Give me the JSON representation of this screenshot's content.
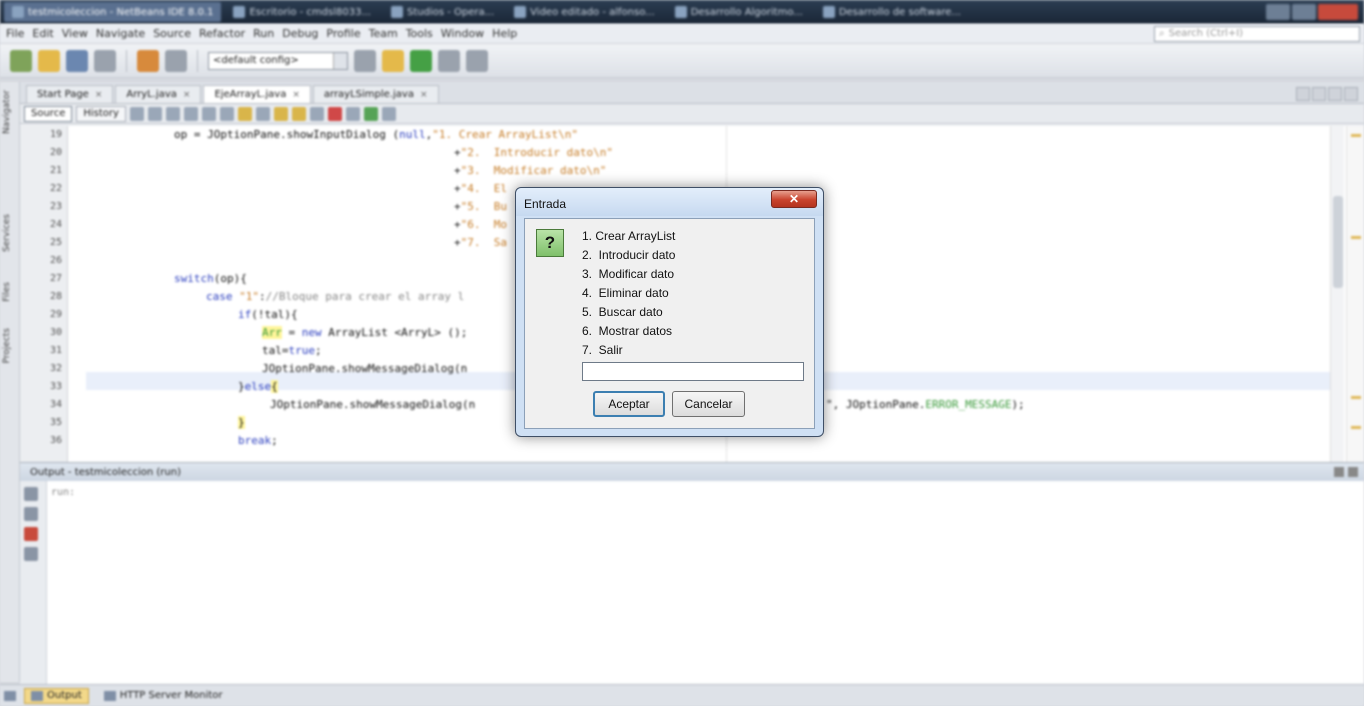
{
  "taskbar": {
    "items": [
      "testmicoleccion - NetBeans IDE 8.0.1",
      "Escritorio - cmdsl8033...",
      "Studios - Opera...",
      "Video editado - alfonso...",
      "Desarrollo Algoritmo...",
      "Desarrollo de software..."
    ]
  },
  "menubar": {
    "items": [
      "File",
      "Edit",
      "View",
      "Navigate",
      "Source",
      "Refactor",
      "Run",
      "Debug",
      "Profile",
      "Team",
      "Tools",
      "Window",
      "Help"
    ],
    "search_placeholder": "Search (Ctrl+I)"
  },
  "toolbar": {
    "config": "<default config>"
  },
  "side_tabs": [
    "Navigator",
    "Services",
    "Files",
    "Projects"
  ],
  "editor": {
    "tabs": [
      {
        "label": "Start Page",
        "active": false
      },
      {
        "label": "ArryL.java",
        "active": false
      },
      {
        "label": "EjeArrayL.java",
        "active": true
      },
      {
        "label": "arrayLSimple.java",
        "active": false
      }
    ],
    "source_label": "Source",
    "history_label": "History",
    "line_numbers": [
      "19",
      "20",
      "21",
      "22",
      "23",
      "24",
      "25",
      "26",
      "27",
      "28",
      "29",
      "30",
      "31",
      "32",
      "33",
      "34",
      "35",
      "36"
    ]
  },
  "output": {
    "title": "Output - testmicoleccion (run)",
    "text": "run:"
  },
  "status": {
    "output_tab": "Output",
    "http_tab": "HTTP Server Monitor"
  },
  "dialog": {
    "title": "Entrada",
    "close_symbol": "✕",
    "question_symbol": "?",
    "options": [
      "1. Crear ArrayList",
      "2.  Introducir dato",
      "3.  Modificar dato",
      "4.  Eliminar dato",
      "5.  Buscar dato",
      "6.  Mostrar datos",
      "7.  Salir"
    ],
    "input_value": "",
    "ok_label": "Aceptar",
    "cancel_label": "Cancelar"
  }
}
